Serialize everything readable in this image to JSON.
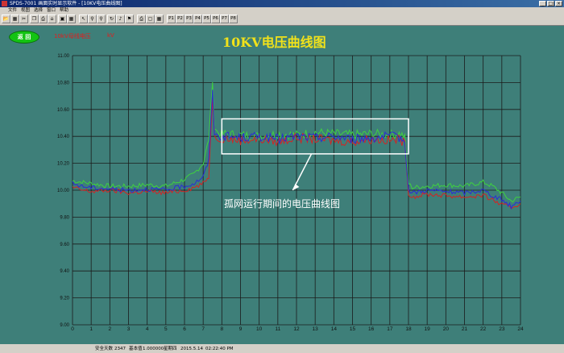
{
  "window": {
    "title": "SPDS-7001 画面实时显示软件 - [10KV电压曲线图]",
    "buttons": [
      "_",
      "□",
      "×"
    ]
  },
  "menu": [
    "文件",
    "视图",
    "选择",
    "窗口",
    "帮助"
  ],
  "toolbar": {
    "icons": [
      "open-icon",
      "save-icon",
      "cut-icon",
      "copy-icon",
      "print-icon",
      "home-icon",
      "chart-icon",
      "map-icon",
      "arrow-icon",
      "zoom-in-icon",
      "zoom-out-icon",
      "refresh-icon",
      "bell-icon",
      "flag-icon",
      "printer-icon",
      "window-icon",
      "tile-icon"
    ],
    "page_buttons": [
      "P1",
      "P2",
      "P3",
      "P4",
      "P5",
      "P6",
      "P7",
      "P8"
    ]
  },
  "screen": {
    "back_button": "返 回",
    "legend_label": "10kV母线电压",
    "unit": "kV",
    "annotation": "孤网运行期间的电压曲线图"
  },
  "colors": {
    "background": "#3e7f79",
    "grid": "#1b1b1b",
    "title": "#f2e21a",
    "series_green": "#3fd13f",
    "series_red": "#d42323",
    "series_blue": "#2b2bd6",
    "highlight_box": "#ffffff"
  },
  "chart_data": {
    "type": "line",
    "title": "10KV电压曲线图",
    "xlabel": "",
    "ylabel": "",
    "xlim": [
      0,
      24
    ],
    "ylim": [
      9.0,
      11.0
    ],
    "x_ticks": [
      "0",
      "1",
      "2",
      "3",
      "4",
      "5",
      "6",
      "7",
      "8",
      "9",
      "10",
      "11",
      "12",
      "13",
      "14",
      "15",
      "16",
      "17",
      "18",
      "19",
      "20",
      "21",
      "22",
      "23",
      "24"
    ],
    "y_ticks": [
      "9.00",
      "9.20",
      "9.40",
      "9.60",
      "9.80",
      "10.00",
      "10.20",
      "10.40",
      "10.60",
      "10.80",
      "11.00"
    ],
    "grid": true,
    "series": [
      {
        "color": "green",
        "x": [
          0,
          0.5,
          1,
          2,
          3,
          4,
          5,
          6,
          6.5,
          7,
          7.3,
          7.5,
          7.6,
          7.8,
          8,
          9,
          10,
          11,
          12,
          13,
          14,
          15,
          16,
          17,
          17.5,
          17.8,
          18,
          18.2,
          19,
          20,
          21,
          22,
          22.5,
          23,
          23.5,
          24
        ],
        "y": [
          10.07,
          10.06,
          10.05,
          10.03,
          10.03,
          10.04,
          10.03,
          10.08,
          10.12,
          10.2,
          10.38,
          10.82,
          10.46,
          10.43,
          10.42,
          10.41,
          10.4,
          10.42,
          10.41,
          10.43,
          10.42,
          10.41,
          10.42,
          10.41,
          10.42,
          10.4,
          10.05,
          10.02,
          10.03,
          10.04,
          10.03,
          10.06,
          10.03,
          9.98,
          9.92,
          9.95
        ]
      },
      {
        "color": "red",
        "x": [
          0,
          0.5,
          1,
          2,
          3,
          4,
          5,
          6,
          6.5,
          7,
          7.3,
          7.5,
          7.6,
          7.8,
          8,
          9,
          10,
          11,
          12,
          13,
          14,
          15,
          16,
          17,
          17.5,
          17.8,
          18,
          18.2,
          19,
          20,
          21,
          22,
          22.5,
          23,
          23.5,
          24
        ],
        "y": [
          10.02,
          10.0,
          9.99,
          10.0,
          9.98,
          9.99,
          9.98,
          10.0,
          10.02,
          10.05,
          10.1,
          10.7,
          10.4,
          10.38,
          10.39,
          10.37,
          10.38,
          10.36,
          10.39,
          10.38,
          10.37,
          10.36,
          10.38,
          10.37,
          10.38,
          10.35,
          9.98,
          9.95,
          9.97,
          9.96,
          9.95,
          9.96,
          9.93,
          9.89,
          9.87,
          9.9
        ]
      },
      {
        "color": "blue",
        "x": [
          0,
          0.5,
          1,
          2,
          3,
          4,
          5,
          6,
          6.5,
          7,
          7.3,
          7.5,
          7.6,
          7.8,
          8,
          9,
          10,
          11,
          12,
          13,
          14,
          15,
          16,
          17,
          17.5,
          17.8,
          18,
          18.2,
          19,
          20,
          21,
          22,
          22.5,
          23,
          23.5,
          24
        ],
        "y": [
          10.05,
          10.03,
          10.02,
          10.01,
          10.0,
          10.01,
          10.0,
          10.03,
          10.05,
          10.1,
          10.22,
          10.76,
          10.42,
          10.4,
          10.4,
          10.39,
          10.4,
          10.38,
          10.4,
          10.39,
          10.4,
          10.38,
          10.39,
          10.4,
          10.39,
          10.37,
          10.0,
          9.98,
          10.0,
          9.99,
          9.98,
          10.0,
          9.96,
          9.93,
          9.88,
          9.92
        ]
      }
    ],
    "annotation_box": {
      "x_range": [
        8,
        18
      ],
      "y_range": [
        10.27,
        10.53
      ]
    }
  },
  "status": {
    "safe_days_label": "安全天数",
    "safe_days": "2347",
    "ratio_label": "基本值",
    "ratio": "1.000000",
    "date": "2015.5.14",
    "time": "02:22:40 PM",
    "weekday": "星期四"
  }
}
